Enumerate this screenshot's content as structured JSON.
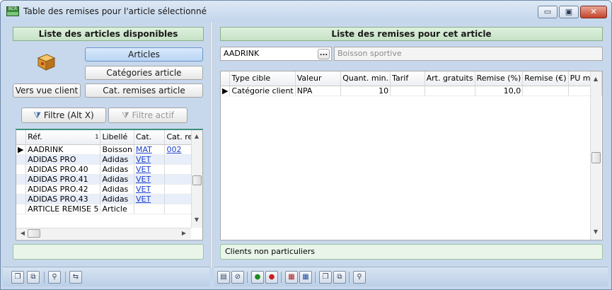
{
  "window": {
    "title": "Table des remises pour l'article sélectionné",
    "icon_text": "BCR",
    "buttons": {
      "minimize": "▭",
      "maximize": "▣",
      "close": "✕"
    }
  },
  "left": {
    "header": "Liste des articles disponibles",
    "buttons": {
      "articles": "Articles",
      "categories": "Catégories article",
      "vers_vue_client": "Vers vue client",
      "cat_remises": "Cat. remises article",
      "filtre": "Filtre (Alt X)",
      "filtre_actif": "Filtre actif"
    },
    "grid": {
      "columns": [
        "Réf.",
        "Libellé",
        "Cat.",
        "Cat. rem"
      ],
      "sort_marker": "1",
      "rows": [
        {
          "ref": "AADRINK",
          "lib": "Boisson",
          "cat": "MAT",
          "catrem": "002",
          "selected": true
        },
        {
          "ref": "ADIDAS PRO",
          "lib": "Adidas",
          "cat": "VET",
          "catrem": ""
        },
        {
          "ref": "ADIDAS PRO.40",
          "lib": "Adidas",
          "cat": "VET",
          "catrem": ""
        },
        {
          "ref": "ADIDAS PRO.41",
          "lib": "Adidas",
          "cat": "VET",
          "catrem": ""
        },
        {
          "ref": "ADIDAS PRO.42",
          "lib": "Adidas",
          "cat": "VET",
          "catrem": ""
        },
        {
          "ref": "ADIDAS PRO.43",
          "lib": "Adidas",
          "cat": "VET",
          "catrem": ""
        },
        {
          "ref": "ARTICLE REMISE 5",
          "lib": "Article",
          "cat": "",
          "catrem": ""
        }
      ]
    },
    "status": ""
  },
  "right": {
    "header": "Liste des remises pour cet article",
    "article_code": "AADRINK",
    "lookup_button": "...",
    "article_label": "Boisson sportive",
    "grid": {
      "columns": [
        "Type cible",
        "Valeur",
        "Quant. min.",
        "Tarif",
        "Art. gratuits",
        "Remise (%)",
        "Remise (€)",
        "PU min."
      ],
      "rows": [
        {
          "type": "Catégorie client",
          "valeur": "NPA",
          "qmin": "10",
          "tarif": "",
          "gratuits": "",
          "remise_pct": "10,0",
          "remise_eur": "",
          "pu": ""
        }
      ]
    },
    "status": "Clients non particuliers"
  },
  "colors": {
    "header_green": "#c6e1c6",
    "selection_blue": "#b9d5f5",
    "link_blue": "#1a3fcf"
  }
}
